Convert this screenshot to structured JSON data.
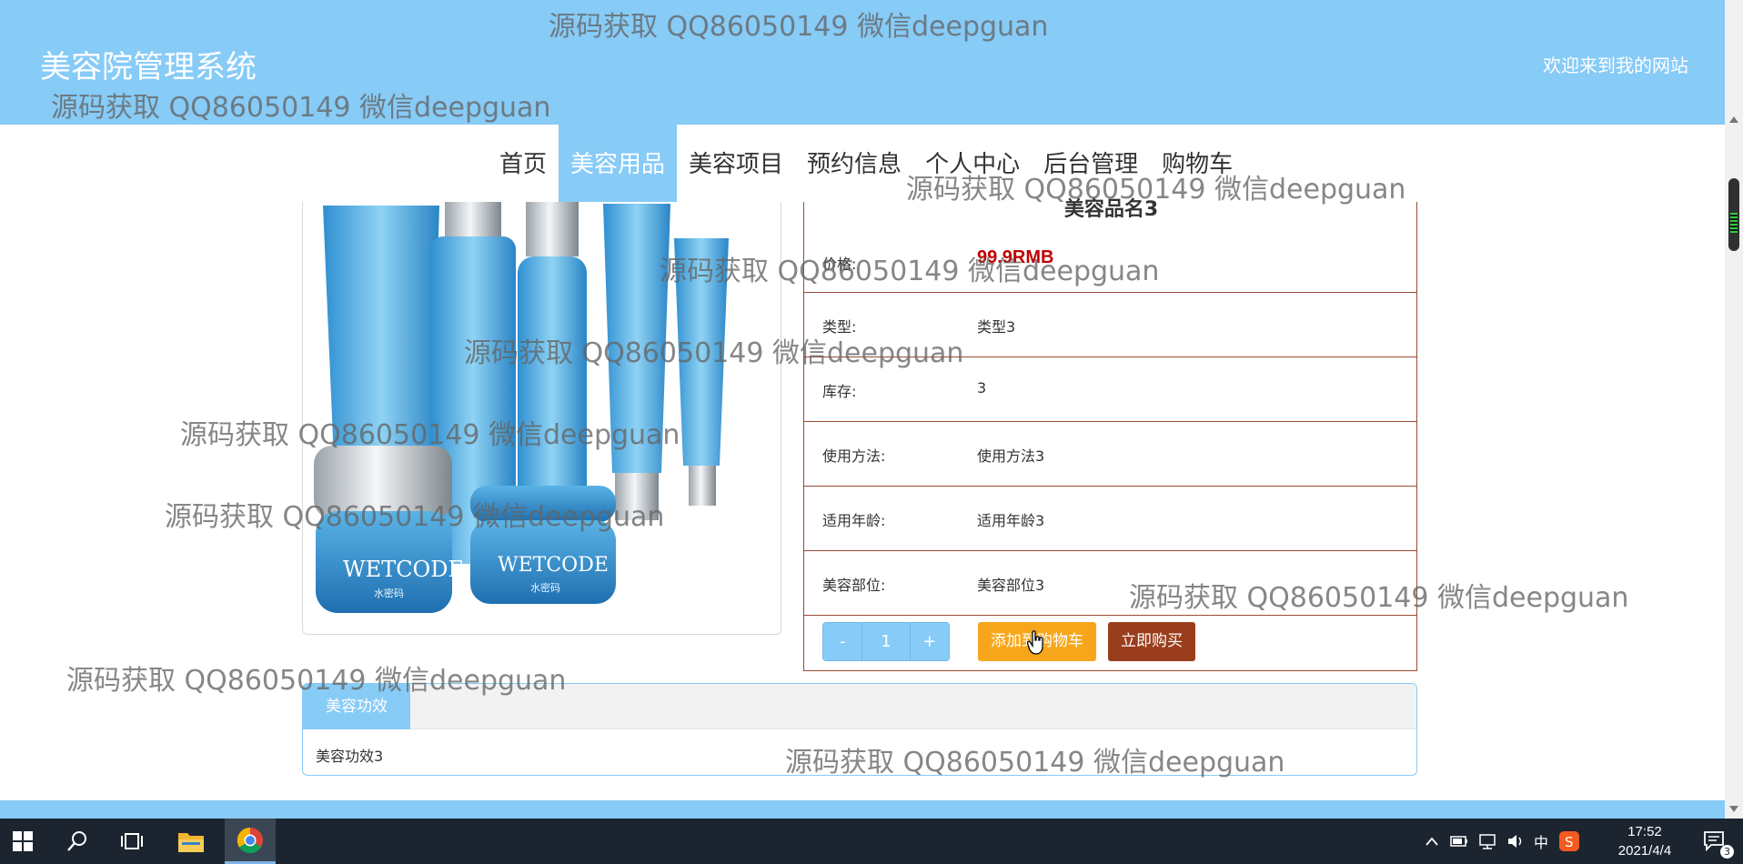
{
  "header": {
    "site_title": "美容院管理系统",
    "welcome": "欢迎来到我的网站",
    "background_color": "#87cbf7"
  },
  "nav": {
    "items": [
      "首页",
      "美容用品",
      "美容项目",
      "预约信息",
      "个人中心",
      "后台管理",
      "购物车"
    ],
    "active_index": 1
  },
  "product": {
    "name": "美容品名3",
    "price_label": "价格:",
    "price_value": "99.9RMB",
    "type_label": "类型:",
    "type_value": "类型3",
    "stock_label": "库存:",
    "stock_value": "3",
    "usage_label": "使用方法:",
    "usage_value": "使用方法3",
    "age_label": "适用年龄:",
    "age_value": "适用年龄3",
    "part_label": "美容部位:",
    "part_value": "美容部位3",
    "image_brand_text": "WETCODE",
    "image_brand_small": "水密码"
  },
  "quantity": {
    "minus": "-",
    "value": "1",
    "plus": "+"
  },
  "actions": {
    "add_to_cart": "添加到购物车",
    "buy_now": "立即购买"
  },
  "effect": {
    "tab_label": "美容功效",
    "content": "美容功效3"
  },
  "watermark": "源码获取 QQ86050149 微信deepguan",
  "taskbar": {
    "ime_label": "中",
    "time": "17:52",
    "date": "2021/4/4",
    "notification_count": "3"
  }
}
